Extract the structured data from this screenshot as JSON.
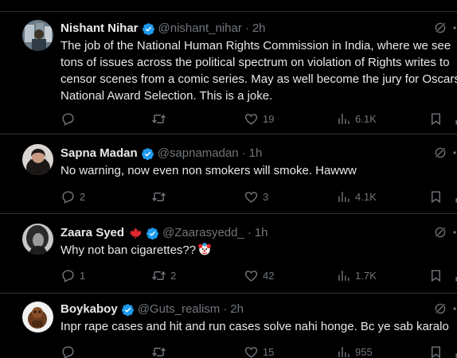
{
  "posts": [
    {
      "name": "Nishant Nihar",
      "handle": "@nishant_nihar",
      "time": "2h",
      "flag": "",
      "text": [
        "The job of the National Human Rights Commission in India, where we see",
        "tons of issues across the political spectrum on violation of Rights writes to",
        "censor scenes from a comic series. May as well become the jury for Oscars",
        "National Award Selection. This is a joke."
      ],
      "replies": "",
      "retweets": "",
      "likes": "19",
      "views": "6.1K"
    },
    {
      "name": "Sapna Madan",
      "handle": "@sapnamadan",
      "time": "1h",
      "flag": "",
      "text": [
        "No warning, now even non smokers will smoke. Hawww"
      ],
      "replies": "2",
      "retweets": "",
      "likes": "3",
      "views": "4.1K"
    },
    {
      "name": "Zaara Syed",
      "handle": "@Zaarasyedd_",
      "time": "1h",
      "flag": "maple-leaf",
      "text": [
        "Why not ban cigarettes??"
      ],
      "text_emoji": "clown-face",
      "replies": "1",
      "retweets": "2",
      "likes": "42",
      "views": "1.7K"
    },
    {
      "name": "Boykaboy",
      "handle": "@Guts_realism",
      "time": "2h",
      "flag": "",
      "text": [
        "Inpr rape cases and hit and run cases solve nahi honge. Bc ye sab karalo"
      ],
      "replies": "",
      "retweets": "",
      "likes": "15",
      "views": "955"
    }
  ],
  "separator": "·",
  "colors": {
    "background": "#000000",
    "text": "#e7e9ea",
    "muted": "#71767b",
    "divider": "#2f3336",
    "verified": "#1d9bf0"
  },
  "icons": [
    "reply-icon",
    "retweet-icon",
    "like-icon",
    "views-icon",
    "bookmark-icon",
    "share-icon",
    "grok-icon",
    "verified-badge-icon",
    "more-icon"
  ]
}
